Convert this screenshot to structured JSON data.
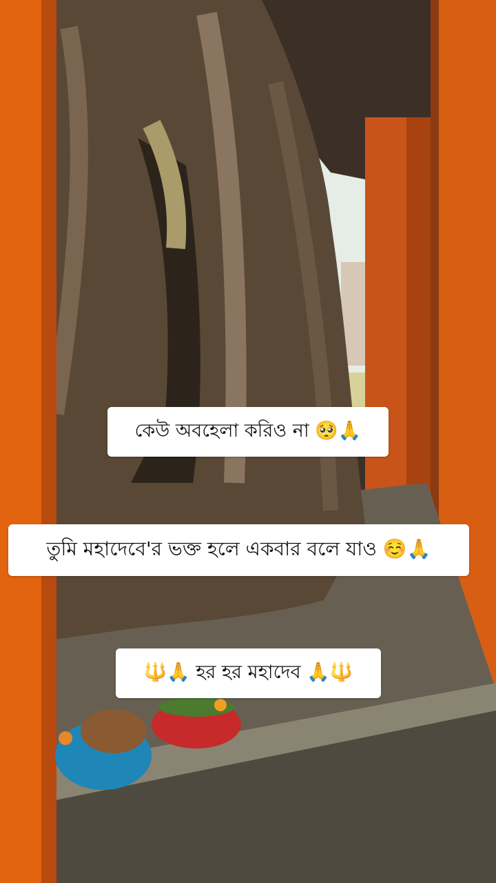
{
  "scene": {
    "description_icon": "banyan-tree-shrine-photo",
    "colors": {
      "pillar": "#e2640f",
      "pillar_shadow": "#b84a10",
      "trunk": "#5c4a38",
      "trunk_dark": "#2f261d",
      "floor": "#6d6557",
      "sky": "#e9efe9",
      "caption_bg": "#ffffff",
      "caption_text": "#111111"
    }
  },
  "captions": [
    {
      "text": "কেউ অবহেলা করিও না 🥺🙏"
    },
    {
      "text": "তুমি মহাদেবে'র ভক্ত হলে একবার বলে যাও ☺️🙏"
    },
    {
      "text": "🔱🙏 হর হর মহাদেব 🙏🔱"
    }
  ]
}
